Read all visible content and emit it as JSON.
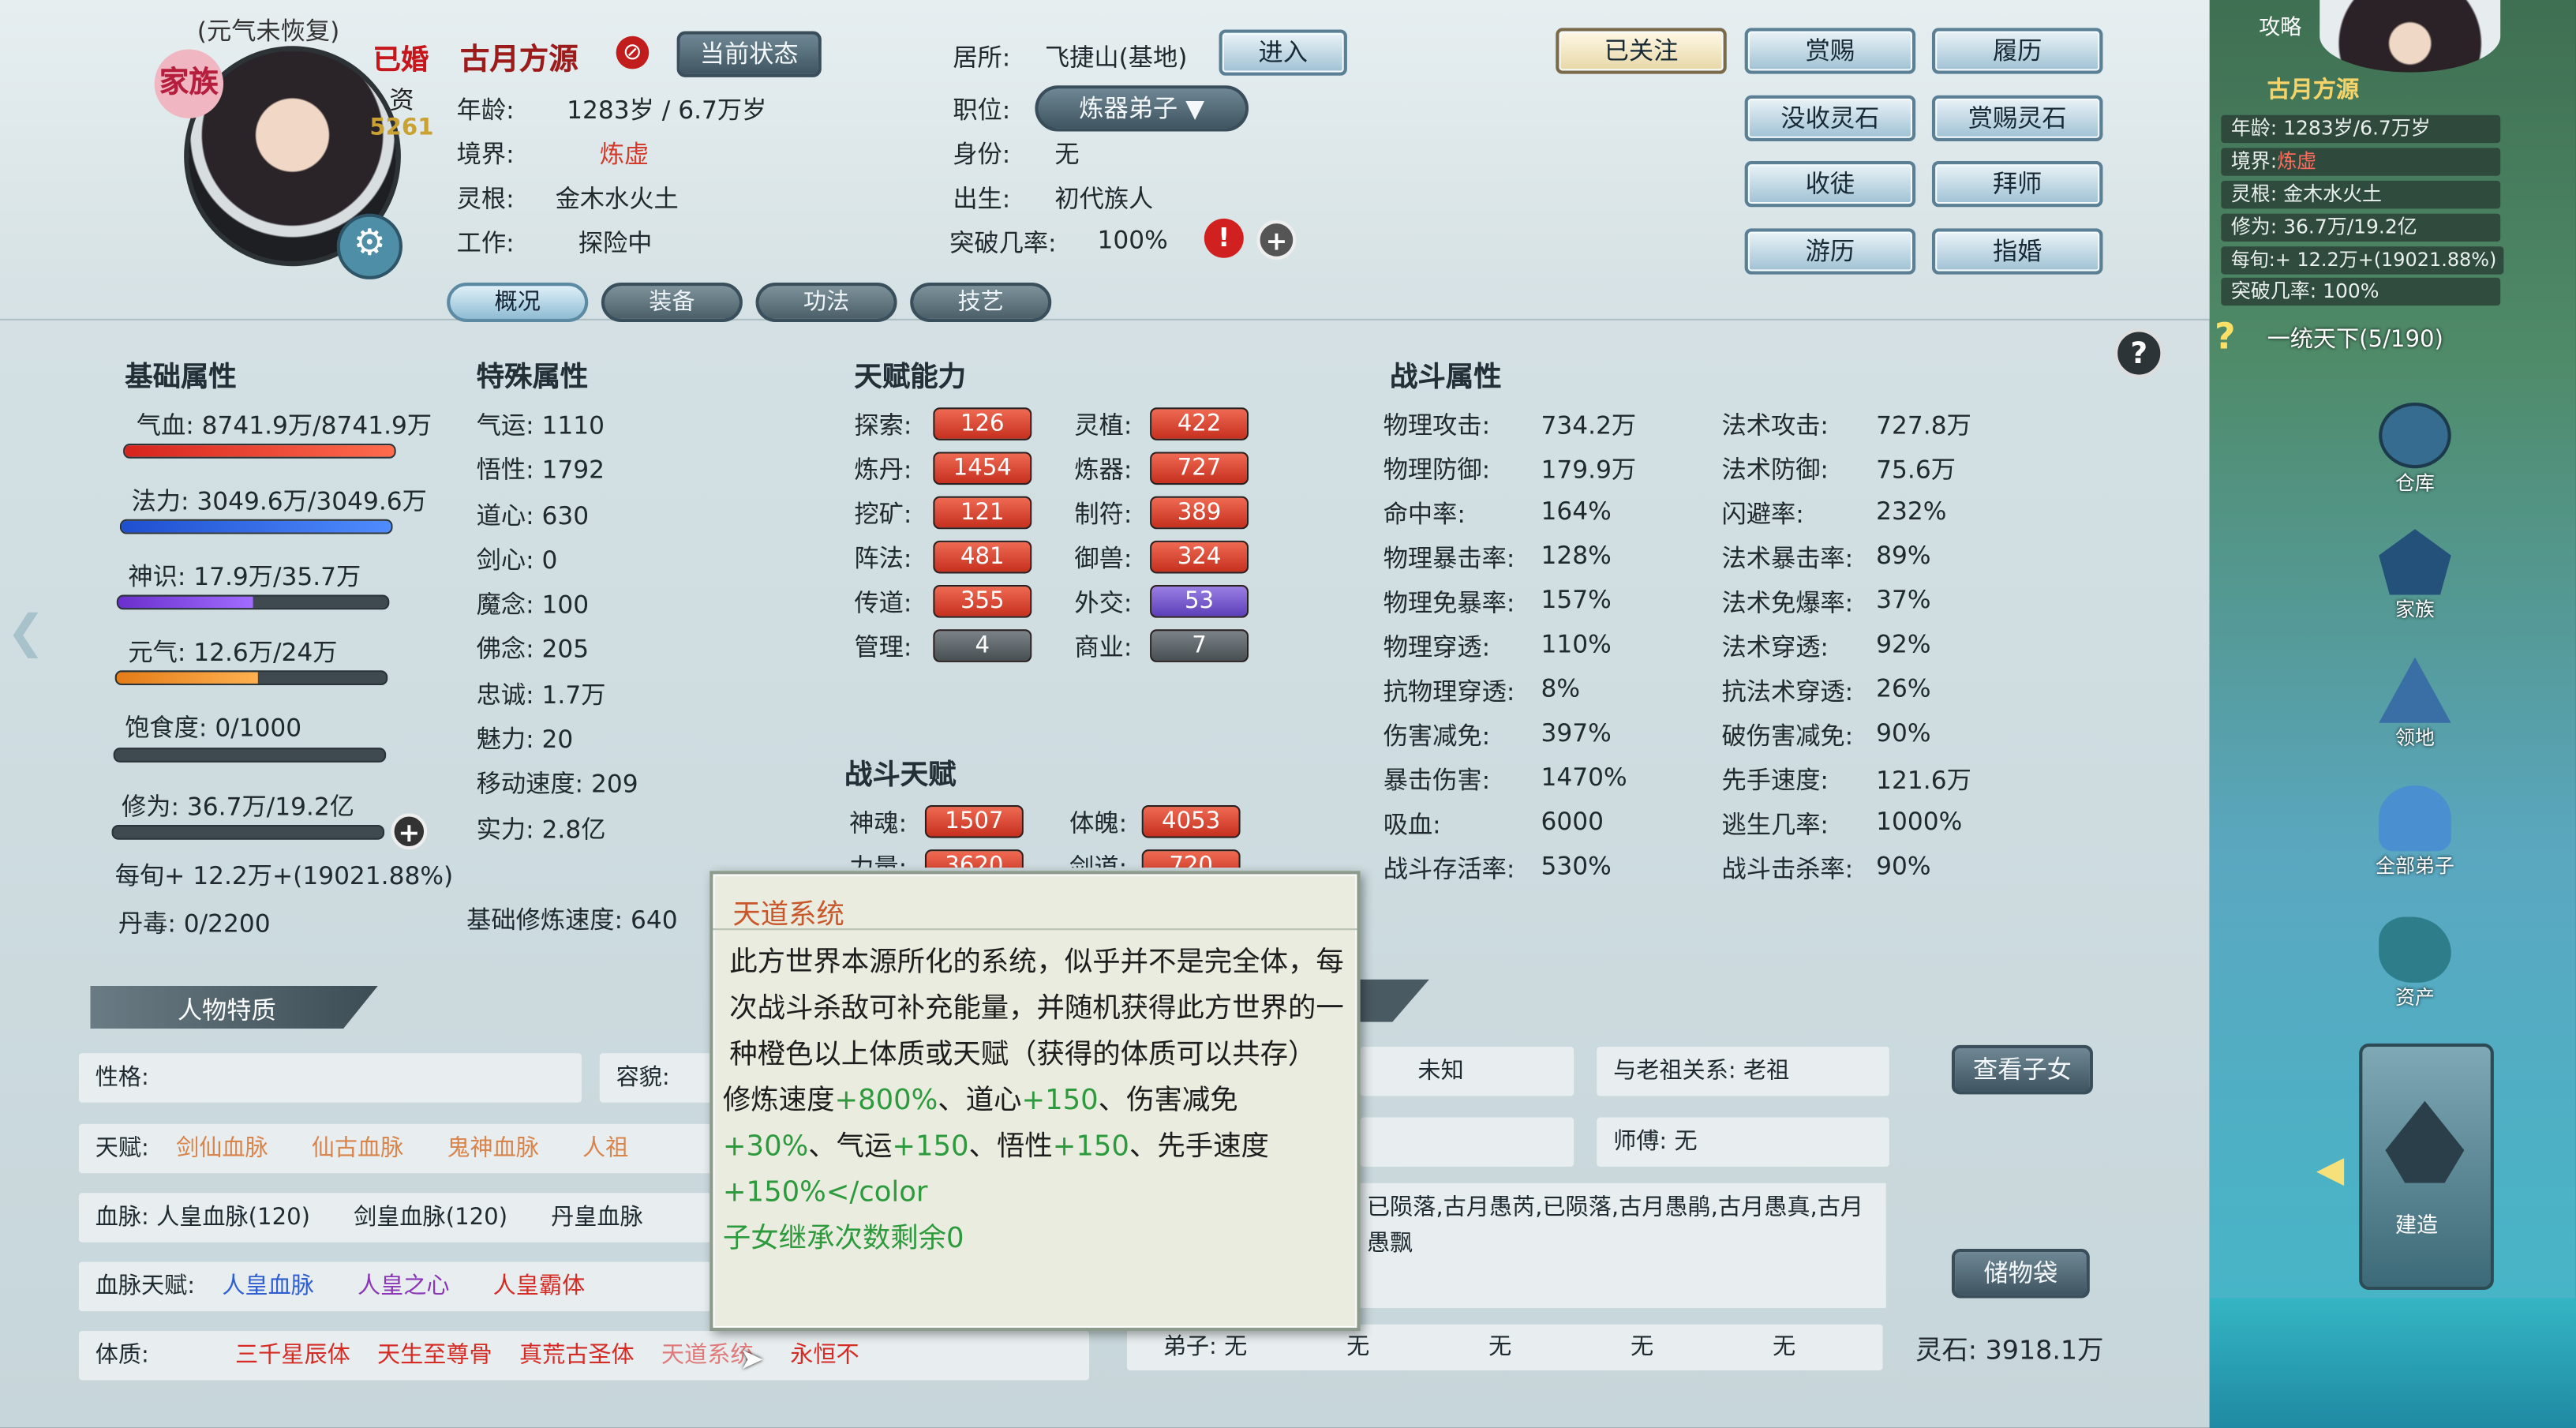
{
  "header": {
    "status_note": "(元气未恢复)",
    "marriage": "已婚",
    "clan_badge": "家族",
    "qualification_label": "资",
    "qualification_value": "5261",
    "name": "古月方源",
    "current_status_btn": "当前状态",
    "age_label": "年龄:",
    "age_value": "1283岁 / 6.7万岁",
    "realm_label": "境界:",
    "realm_value": "炼虚",
    "root_label": "灵根:",
    "root_value": "金木水火土",
    "work_label": "工作:",
    "work_value": "探险中",
    "residence_label": "居所:",
    "residence_value": "飞捷山(基地)",
    "enter_btn": "进入",
    "position_label": "职位:",
    "position_value": "炼器弟子",
    "identity_label": "身份:",
    "identity_value": "无",
    "birth_label": "出生:",
    "birth_value": "初代族人",
    "breakthrough_label": "突破几率:",
    "breakthrough_value": "100%"
  },
  "actions": {
    "followed": "已关注",
    "reward": "赏赐",
    "resume": "履历",
    "confiscate": "没收灵石",
    "reward_stones": "赏赐灵石",
    "take_disciple": "收徒",
    "become_disciple": "拜师",
    "travel": "游历",
    "arrange_marriage": "指婚"
  },
  "tabs": [
    "概况",
    "装备",
    "功法",
    "技艺"
  ],
  "basic": {
    "title": "基础属性",
    "hp": "气血: 8741.9万/8741.9万",
    "mp": "法力: 3049.6万/3049.6万",
    "spirit": "神识: 17.9万/35.7万",
    "vitality": "元气: 12.6万/24万",
    "satiety": "饱食度: 0/1000",
    "cultivation": "修为: 36.7万/19.2亿",
    "per_month": "每旬+ 12.2万+(19021.88%)",
    "poison": "丹毒: 0/2200"
  },
  "bars": {
    "hp": 1.0,
    "mp": 1.0,
    "spirit": 0.5,
    "vitality": 0.525,
    "satiety": 0.0,
    "cultivation": 0.0002
  },
  "special": {
    "title": "特殊属性",
    "items": [
      "气运: 1110",
      "悟性: 1792",
      "道心: 630",
      "剑心: 0",
      "魔念: 100",
      "佛念: 205",
      "忠诚: 1.7万",
      "魅力: 20",
      "移动速度: 209",
      "实力: 2.8亿"
    ],
    "base_speed": "基础修炼速度: 640"
  },
  "talent": {
    "title": "天赋能力",
    "left": [
      {
        "k": "探索:",
        "v": "126"
      },
      {
        "k": "炼丹:",
        "v": "1454"
      },
      {
        "k": "挖矿:",
        "v": "121"
      },
      {
        "k": "阵法:",
        "v": "481"
      },
      {
        "k": "传道:",
        "v": "355"
      },
      {
        "k": "管理:",
        "v": "4"
      }
    ],
    "right": [
      {
        "k": "灵植:",
        "v": "422"
      },
      {
        "k": "炼器:",
        "v": "727"
      },
      {
        "k": "制符:",
        "v": "389"
      },
      {
        "k": "御兽:",
        "v": "324"
      },
      {
        "k": "外交:",
        "v": "53"
      },
      {
        "k": "商业:",
        "v": "7"
      }
    ]
  },
  "battle_talent": {
    "title": "战斗天赋",
    "items": [
      {
        "k": "神魂:",
        "v": "1507"
      },
      {
        "k": "体魄:",
        "v": "4053"
      },
      {
        "k": "力量:",
        "v": "3620"
      },
      {
        "k": "剑道:",
        "v": "720"
      }
    ]
  },
  "combat": {
    "title": "战斗属性",
    "left": [
      "物理攻击:",
      "物理防御:",
      "命中率:",
      "物理暴击率:",
      "物理免暴率:",
      "物理穿透:",
      "抗物理穿透:",
      "伤害减免:",
      "暴击伤害:",
      "吸血:",
      "战斗存活率:"
    ],
    "left_v": [
      "734.2万",
      "179.9万",
      "164%",
      "128%",
      "157%",
      "110%",
      "8%",
      "397%",
      "1470%",
      "6000",
      "530%"
    ],
    "right": [
      "法术攻击:",
      "法术防御:",
      "闪避率:",
      "法术暴击率:",
      "法术免爆率:",
      "法术穿透:",
      "抗法术穿透:",
      "破伤害减免:",
      "先手速度:",
      "逃生几率:",
      "战斗击杀率:"
    ],
    "right_v": [
      "727.8万",
      "75.6万",
      "232%",
      "89%",
      "37%",
      "92%",
      "26%",
      "90%",
      "121.6万",
      "1000%",
      "90%"
    ]
  },
  "traits": {
    "title": "人物特质",
    "personality": "性格:",
    "looks": "容貌:",
    "talent_label": "天赋:",
    "talents": [
      "剑仙血脉",
      "仙古血脉",
      "鬼神血脉",
      "人祖"
    ],
    "bloodline_label": "血脉:",
    "bloodlines": [
      "人皇血脉(120)",
      "剑皇血脉(120)",
      "丹皇血脉"
    ],
    "bloodline_talent_label": "血脉天赋:",
    "bloodline_talents": [
      "人皇血脉",
      "人皇之心",
      "人皇霸体"
    ],
    "physique_label": "体质:",
    "physiques": [
      "三千星辰体",
      "天生至尊骨",
      "真荒古圣体",
      "天道系统",
      "永恒不"
    ]
  },
  "relations": {
    "unknown": "未知",
    "elder": "与老祖关系: 老祖",
    "view_children": "查看子女",
    "master": "师傅: 无",
    "family_text": "已陨落,古月愚芮,已陨落,古月愚鹃,古月愚真,古月愚飘",
    "storage_bag": "储物袋",
    "disciples": "弟子: 无",
    "d2": "无",
    "d3": "无",
    "d4": "无",
    "d5": "无",
    "spirit_stones": "灵石: 3918.1万"
  },
  "tooltip": {
    "title": "天道系统",
    "desc": "此方世界本源所化的系统，似乎并不是完全体，每次战斗杀敌可补充能量，并随机获得此方世界的一种橙色以上体质或天赋（获得的体质可以共存）",
    "effect_a": "修炼速度",
    "effect_a_v": "+800%",
    "effect_b": "、道心",
    "effect_b_v": "+150",
    "effect_c": "、伤害减免",
    "effect_c_v": "+30%",
    "effect_d": "、气运",
    "effect_d_v": "+150",
    "effect_e": "、悟性",
    "effect_e_v": "+150",
    "effect_f": "、先手速度",
    "effect_f_v": "+150%</color",
    "inherit": "子女继承次数剩余0"
  },
  "sidebar": {
    "strategy": "攻略",
    "name": "古月方源",
    "age": "年龄: 1283岁/6.7万岁",
    "realm_label": "境界:",
    "realm": "炼虚",
    "root": "灵根: 金木水火土",
    "cult": "修为: 36.7万/19.2亿",
    "month": "每旬:+ 12.2万+(19021.88%)",
    "break": "突破几率: 100%",
    "quest": "一统天下(5/190)",
    "icons": [
      "仓库",
      "家族",
      "领地",
      "全部弟子",
      "资产",
      "建造"
    ]
  },
  "colors": {
    "accent_red": "#d63a2b",
    "green": "#2e9a3e",
    "orange": "#c9572b"
  }
}
